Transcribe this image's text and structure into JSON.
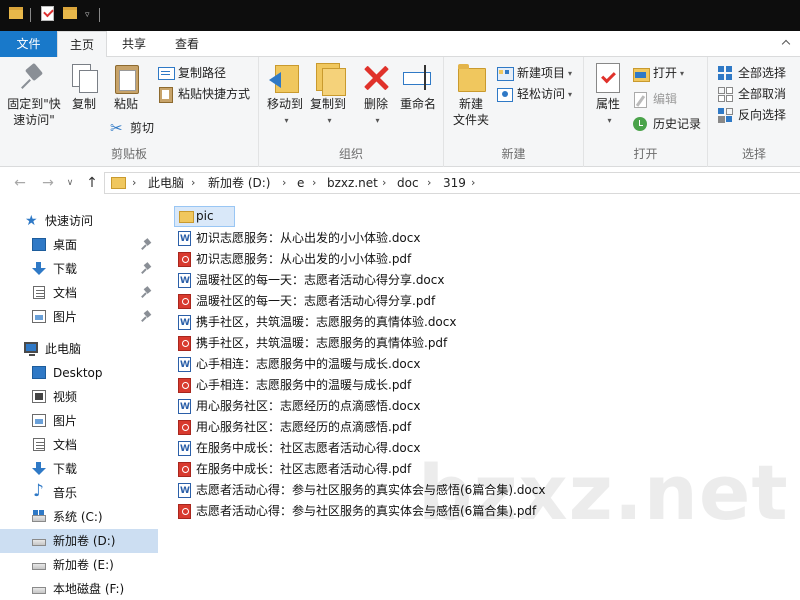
{
  "quick_access_toolbar": {
    "dropdown_glyph": "▿"
  },
  "tabs": {
    "file": "文件",
    "home": "主页",
    "share": "共享",
    "view": "查看"
  },
  "ribbon": {
    "clipboard": {
      "label": "剪贴板",
      "pin_quick_access_line1": "固定到\"快",
      "pin_quick_access_line2": "速访问\"",
      "copy": "复制",
      "paste": "粘贴",
      "copy_path": "复制路径",
      "paste_shortcut": "粘贴快捷方式",
      "cut": "剪切"
    },
    "organize": {
      "label": "组织",
      "move_to": "移动到",
      "copy_to": "复制到",
      "delete": "删除",
      "rename": "重命名"
    },
    "new": {
      "label": "新建",
      "new_folder_line1": "新建",
      "new_folder_line2": "文件夹",
      "new_item": "新建项目",
      "easy_access": "轻松访问"
    },
    "open": {
      "label": "打开",
      "properties": "属性",
      "open": "打开",
      "edit": "编辑",
      "history": "历史记录"
    },
    "select": {
      "label": "选择",
      "select_all": "全部选择",
      "select_none": "全部取消",
      "invert": "反向选择"
    }
  },
  "address": {
    "back_glyph": "←",
    "forward_glyph": "→",
    "up_glyph": "↑",
    "chevron": "∨",
    "breadcrumbs": [
      "此电脑",
      "新加卷 (D:)",
      "e",
      "bzxz.net",
      "doc",
      "319"
    ],
    "separator": "›"
  },
  "sidebar": {
    "quick_access": "快速访问",
    "quick_items": [
      "桌面",
      "下载",
      "文档",
      "图片"
    ],
    "this_pc": "此电脑",
    "pc_items": [
      "Desktop",
      "视频",
      "图片",
      "文档",
      "下载",
      "音乐"
    ],
    "drives": [
      "系统 (C:)",
      "新加卷 (D:)",
      "新加卷 (E:)",
      "本地磁盘 (F:)"
    ]
  },
  "files": [
    {
      "name": "pic",
      "type": "folder"
    },
    {
      "name": "初识志愿服务：从心出发的小小体验.docx",
      "type": "docx"
    },
    {
      "name": "初识志愿服务：从心出发的小小体验.pdf",
      "type": "pdf"
    },
    {
      "name": "温暖社区的每一天：志愿者活动心得分享.docx",
      "type": "docx"
    },
    {
      "name": "温暖社区的每一天：志愿者活动心得分享.pdf",
      "type": "pdf"
    },
    {
      "name": "携手社区，共筑温暖：志愿服务的真情体验.docx",
      "type": "docx"
    },
    {
      "name": "携手社区，共筑温暖：志愿服务的真情体验.pdf",
      "type": "pdf"
    },
    {
      "name": "心手相连：志愿服务中的温暖与成长.docx",
      "type": "docx"
    },
    {
      "name": "心手相连：志愿服务中的温暖与成长.pdf",
      "type": "pdf"
    },
    {
      "name": "用心服务社区：志愿经历的点滴感悟.docx",
      "type": "docx"
    },
    {
      "name": "用心服务社区：志愿经历的点滴感悟.pdf",
      "type": "pdf"
    },
    {
      "name": "在服务中成长：社区志愿者活动心得.docx",
      "type": "docx"
    },
    {
      "name": "在服务中成长：社区志愿者活动心得.pdf",
      "type": "pdf"
    },
    {
      "name": "志愿者活动心得：参与社区服务的真实体会与感悟(6篇合集).docx",
      "type": "docx"
    },
    {
      "name": "志愿者活动心得：参与社区服务的真实体会与感悟(6篇合集).pdf",
      "type": "pdf"
    }
  ],
  "watermark": "bzxz.net"
}
